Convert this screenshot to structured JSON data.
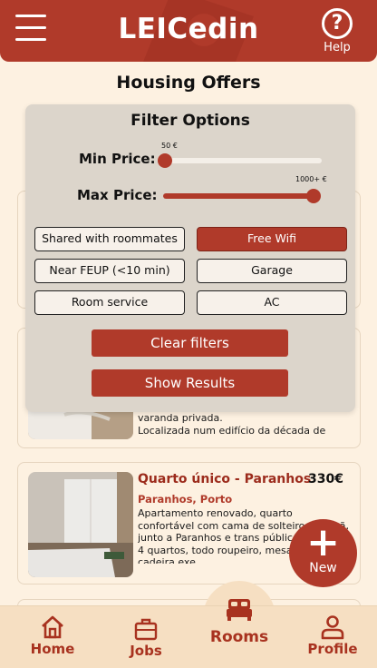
{
  "header": {
    "logo": "LEICedin",
    "help_label": "Help",
    "help_glyph": "?"
  },
  "page_title": "Housing Offers",
  "filter": {
    "title": "Filter Options",
    "min_price_label": "Min Price:",
    "min_price_value": "50 €",
    "min_price_fraction": 0.0,
    "max_price_label": "Max Price:",
    "max_price_value": "1000+ €",
    "max_price_fraction": 1.0,
    "chips": [
      {
        "label": "Shared with roommates",
        "active": false
      },
      {
        "label": "Free Wifi",
        "active": true
      },
      {
        "label": "Near FEUP (<10 min)",
        "active": false
      },
      {
        "label": "Garage",
        "active": false
      },
      {
        "label": "Room service",
        "active": false
      },
      {
        "label": "AC",
        "active": false
      }
    ],
    "clear_label": "Clear filters",
    "show_label": "Show Results"
  },
  "listings": [
    {
      "desc_line1": "varanda privada.",
      "desc_line2": "Localizada num edifício da década de"
    },
    {
      "title": "Quarto único - Paranhos",
      "price": "330€",
      "location": "Paranhos, Porto",
      "desc": "Apartamento renovado, quarto confortável com cama de solteiro, manhã, junto a Paranhos e trans público, oferece 4 quartos, todo roupeiro, mesa, luz, cadeira exe"
    }
  ],
  "fab": {
    "plus": "+",
    "label": "New"
  },
  "nav": {
    "home": "Home",
    "jobs": "Jobs",
    "rooms": "Rooms",
    "profile": "Profile"
  },
  "colors": {
    "brand": "#b03a2a",
    "background": "#fdf1e1",
    "nav_background": "#f6dfc2",
    "panel": "#dcd5cb"
  }
}
